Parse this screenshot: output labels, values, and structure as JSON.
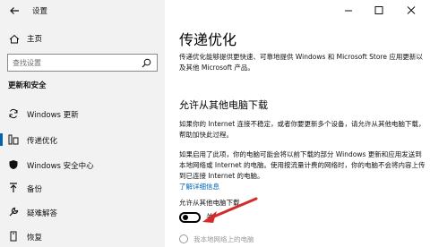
{
  "window": {
    "title": "设置"
  },
  "sidebar": {
    "home_label": "主页",
    "search_placeholder": "查找设置",
    "section_title": "更新和安全",
    "items": [
      {
        "label": "Windows 更新",
        "icon": "sync-icon"
      },
      {
        "label": "传递优化",
        "icon": "delivery-optimization-icon",
        "selected": true
      },
      {
        "label": "Windows 安全中心",
        "icon": "shield-icon"
      },
      {
        "label": "备份",
        "icon": "backup-icon"
      },
      {
        "label": "疑难解答",
        "icon": "wrench-icon"
      },
      {
        "label": "恢复",
        "icon": "recovery-icon"
      }
    ]
  },
  "main": {
    "title": "传递优化",
    "intro": "传递优化能够提供更快速、可靠地提供 Windows 和 Microsoft Store 应用更新以及其他 Microsoft 产品。",
    "subheading": "允许从其他电脑下载",
    "p2": "如果你的 Internet 连接不稳定，或者你要更新多个设备，请允许从其他电脑下载，帮助加快此过程。",
    "p3": "如果启用了此项，你的电脑可能会将以前下载的部分 Windows 更新和应用发送到本地网络或 Internet 的电脑。使用按流量计费的网络时，你的电脑不会将内容上传到已连接 Internet 的电脑。",
    "learn_more": "了解详细信息",
    "toggle_label": "允许从其他电脑下载",
    "toggle_state": "关",
    "toggle_on": false,
    "radio_label": "我本地网络上的电脑"
  },
  "colors": {
    "accent": "#0063b1",
    "annotation_arrow": "#d42a2a"
  }
}
